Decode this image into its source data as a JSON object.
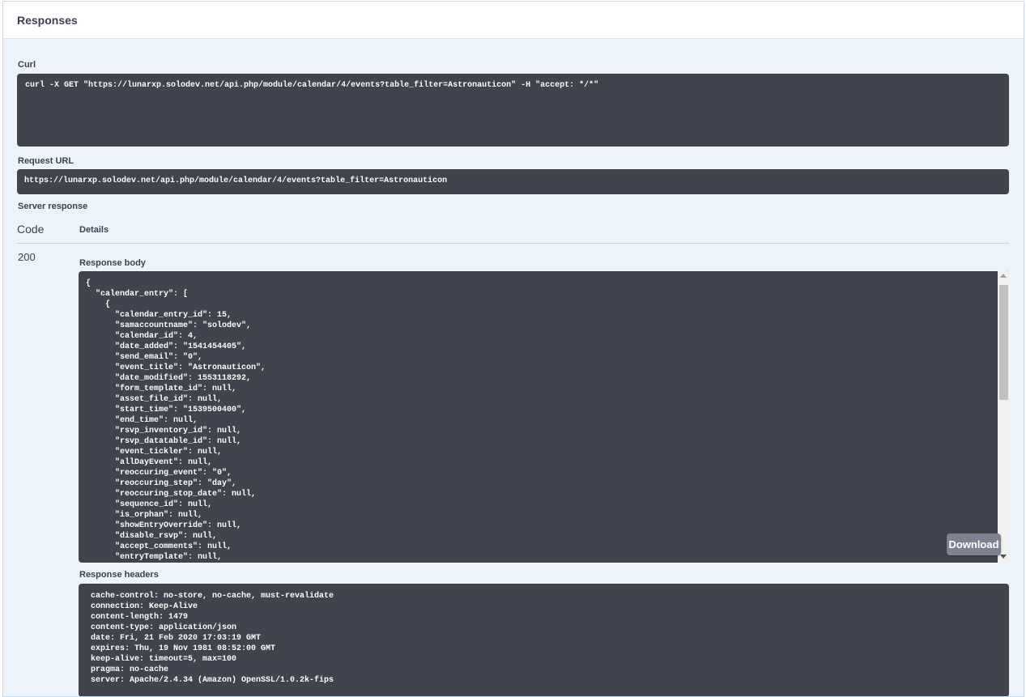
{
  "responses": {
    "title": "Responses",
    "curl_label": "Curl",
    "curl_command": "curl -X GET \"https://lunarxp.solodev.net/api.php/module/calendar/4/events?table_filter=Astronauticon\" -H \"accept: */*\"",
    "request_url_label": "Request URL",
    "request_url": "https://lunarxp.solodev.net/api.php/module/calendar/4/events?table_filter=Astronauticon",
    "server_response_label": "Server response",
    "code_header": "Code",
    "details_header": "Details",
    "status_code": "200",
    "response_body_label": "Response body",
    "response_body": "{\n  \"calendar_entry\": [\n    {\n      \"calendar_entry_id\": 15,\n      \"samaccountname\": \"solodev\",\n      \"calendar_id\": 4,\n      \"date_added\": \"1541454405\",\n      \"send_email\": \"0\",\n      \"event_title\": \"Astronauticon\",\n      \"date_modified\": 1553118292,\n      \"form_template_id\": null,\n      \"asset_file_id\": null,\n      \"start_time\": \"1539500400\",\n      \"end_time\": null,\n      \"rsvp_inventory_id\": null,\n      \"rsvp_datatable_id\": null,\n      \"event_tickler\": null,\n      \"allDayEvent\": null,\n      \"reoccuring_event\": \"0\",\n      \"reoccuring_step\": \"day\",\n      \"reoccuring_stop_date\": null,\n      \"sequence_id\": null,\n      \"is_orphan\": null,\n      \"showEntryOverride\": null,\n      \"disable_rsvp\": null,\n      \"accept_comments\": null,\n      \"entryTemplate\": null,",
    "download_label": "Download",
    "response_headers_label": "Response headers",
    "response_headers": "cache-control: no-store, no-cache, must-revalidate\nconnection: Keep-Alive\ncontent-length: 1479\ncontent-type: application/json\ndate: Fri, 21 Feb 2020 17:03:19 GMT\nexpires: Thu, 19 Nov 1981 08:52:00 GMT\nkeep-alive: timeout=5, max=100\npragma: no-cache\nserver: Apache/2.4.34 (Amazon) OpenSSL/1.0.2k-fips"
  },
  "colors": {
    "panel_bg": "#ecf3fb",
    "code_bg": "#41444e",
    "download_bg": "#7d8293"
  }
}
